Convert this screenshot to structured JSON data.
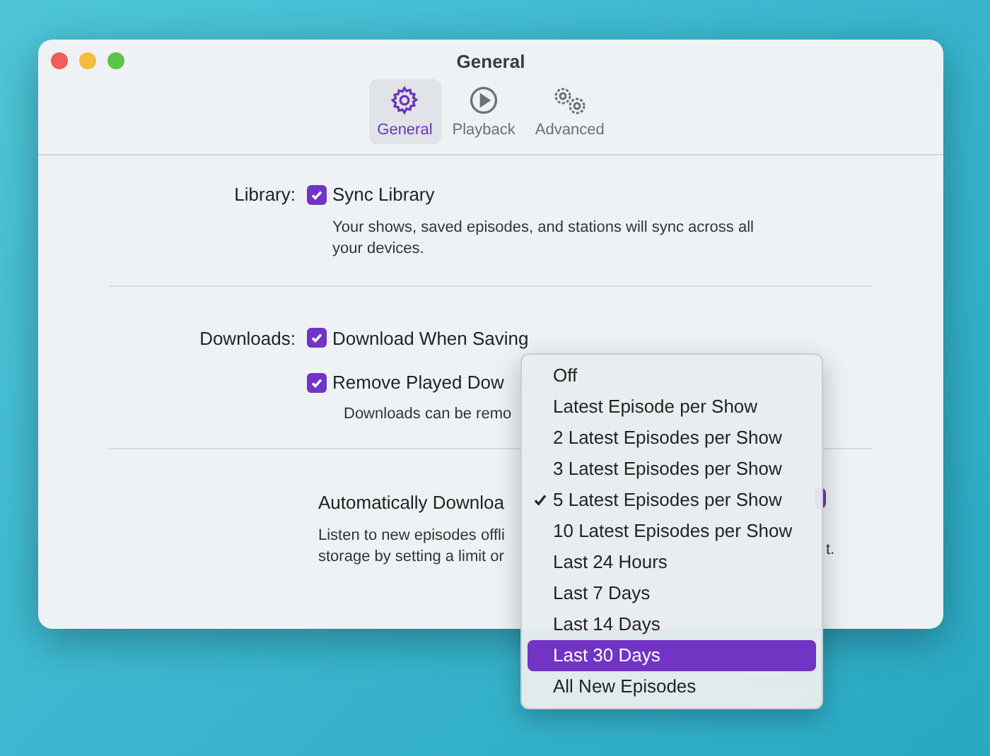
{
  "window": {
    "title": "General"
  },
  "tabs": [
    {
      "label": "General",
      "selected": true,
      "kind": "gear"
    },
    {
      "label": "Playback",
      "selected": false,
      "kind": "play"
    },
    {
      "label": "Advanced",
      "selected": false,
      "kind": "gears"
    }
  ],
  "library": {
    "label": "Library:",
    "option": {
      "label": "Sync Library",
      "checked": true
    },
    "note_lines": [
      "Your shows, saved episodes, and stations will sync across all",
      "your devices."
    ]
  },
  "downloads": {
    "label": "Downloads:",
    "options": [
      {
        "label": "Download When Saving",
        "checked": true
      },
      {
        "label": "Remove Played Dow",
        "checked": true
      }
    ],
    "note": "Downloads can be remo"
  },
  "auto_download": {
    "label": "Automatically Downloa",
    "note_lines": [
      "Listen to new episodes offli",
      "storage by setting a limit or"
    ],
    "note_tail": "t."
  },
  "menu": {
    "items": [
      {
        "label": "Off",
        "checked": false,
        "selected": false
      },
      {
        "label": "Latest Episode per Show",
        "checked": false,
        "selected": false
      },
      {
        "label": "2 Latest Episodes per Show",
        "checked": false,
        "selected": false
      },
      {
        "label": "3 Latest Episodes per Show",
        "checked": false,
        "selected": false
      },
      {
        "label": "5 Latest Episodes per Show",
        "checked": true,
        "selected": false
      },
      {
        "label": "10 Latest Episodes per Show",
        "checked": false,
        "selected": false
      },
      {
        "label": "Last 24 Hours",
        "checked": false,
        "selected": false
      },
      {
        "label": "Last 7 Days",
        "checked": false,
        "selected": false
      },
      {
        "label": "Last 14 Days",
        "checked": false,
        "selected": false
      },
      {
        "label": "Last 30 Days",
        "checked": false,
        "selected": true
      },
      {
        "label": "All New Episodes",
        "checked": false,
        "selected": false
      }
    ]
  }
}
